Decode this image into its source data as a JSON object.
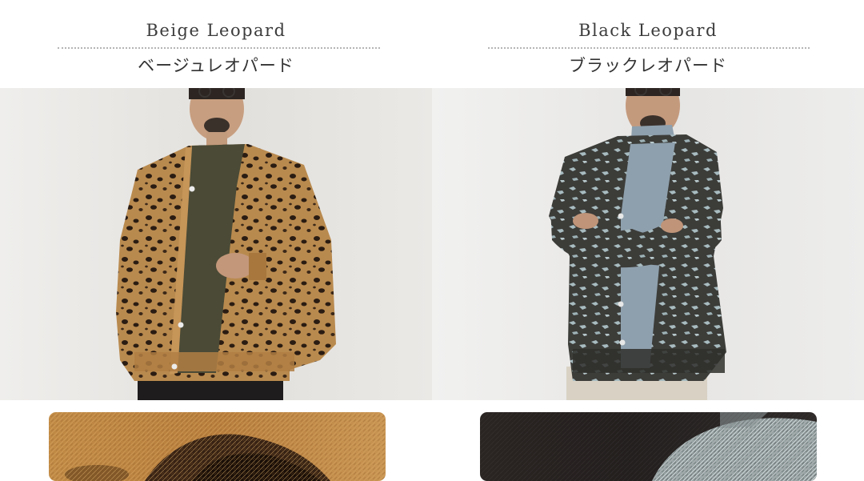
{
  "products": [
    {
      "title_en": "Beige Leopard",
      "title_ja": "ベージュレオパード",
      "colors": {
        "base": "#b98a4e",
        "spot": "#2a1c12",
        "inner": "#4a4a36",
        "pants": "#1e1c1c"
      }
    },
    {
      "title_en": "Black Leopard",
      "title_ja": "ブラックレオパード",
      "colors": {
        "base": "#3c3c39",
        "spot": "#a8bcc0",
        "inner": "#8ea0ad",
        "pants": "#d9d2c4"
      }
    }
  ]
}
